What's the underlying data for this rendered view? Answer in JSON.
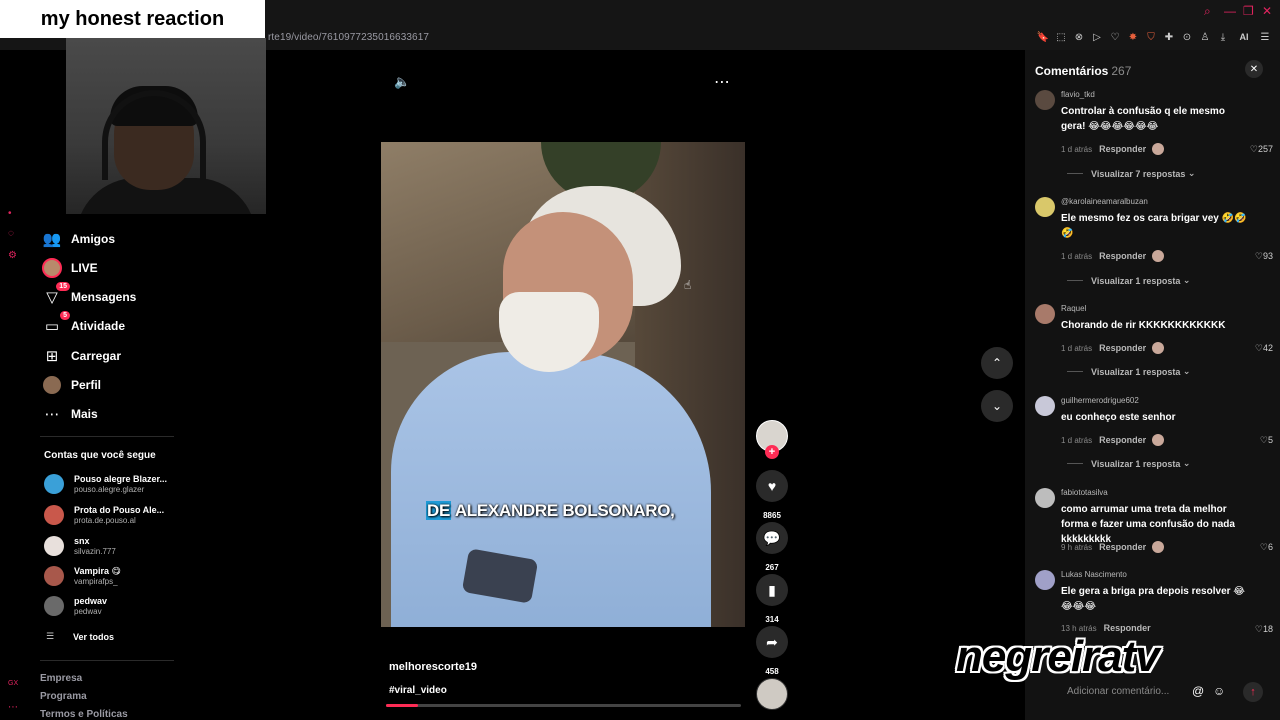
{
  "browser": {
    "url": "rte19/video/7610977235016633617",
    "toolbar_icons": [
      "bookmark-icon",
      "screenshot-icon",
      "block-icon",
      "play-icon",
      "heart-icon",
      "fox-icon",
      "shield-icon",
      "puzzle-icon",
      "lock-icon",
      "profile-icon",
      "download-icon",
      "pen-icon",
      "menu-icon"
    ],
    "ai_label": "AI"
  },
  "overlay": {
    "title": "my honest reaction"
  },
  "sidebar": {
    "nav": [
      {
        "label": "Amigos",
        "icon": "friends-icon"
      },
      {
        "label": "LIVE",
        "icon": "live-icon"
      },
      {
        "label": "Mensagens",
        "icon": "messages-icon",
        "badge": "15"
      },
      {
        "label": "Atividade",
        "icon": "activity-icon",
        "badge": "5"
      },
      {
        "label": "Carregar",
        "icon": "upload-icon"
      },
      {
        "label": "Perfil",
        "icon": "profile-icon"
      },
      {
        "label": "Mais",
        "icon": "more-icon"
      }
    ],
    "following_title": "Contas que você segue",
    "following": [
      {
        "name": "Pouso alegre Blazer...",
        "user": "pouso.alegre.glazer",
        "color": "#3aa0d8"
      },
      {
        "name": "Prota do Pouso Ale...",
        "user": "prota.de.pouso.al",
        "color": "#c9584b"
      },
      {
        "name": "snx",
        "user": "silvazin.777",
        "color": "#e8e0dc"
      },
      {
        "name": "Vampira 😋",
        "user": "vampirafps_",
        "color": "#a8584b"
      },
      {
        "name": "pedwav",
        "user": "pedwav",
        "color": "#6a6a6a"
      }
    ],
    "see_all": "Ver todos",
    "footer": [
      "Empresa",
      "Programa",
      "Termos e Políticas"
    ]
  },
  "video": {
    "caption_highlight": "DE",
    "caption_rest": " ALEXANDRE BOLSONARO,",
    "author": "melhorescorte19",
    "hashtag": "#viral_video",
    "progress": 0.09
  },
  "actions": {
    "likes": "8865",
    "comments": "267",
    "saves": "314",
    "shares": "458"
  },
  "comments_panel": {
    "title": "Comentários",
    "count": "267",
    "reply_label": "Responder",
    "input_placeholder": "Adicionar comentário...",
    "items": [
      {
        "user": "flavio_tkd",
        "text": "Controlar à confusão q ele mesmo gera! 😂😂😂😂😂😂",
        "time": "1 d atrás",
        "likes": "257",
        "replies": "Visualizar 7 respostas",
        "color": "#5a4a40"
      },
      {
        "user": "@karolaineamaralbuzan",
        "text": "Ele mesmo fez os cara brigar vey 🤣🤣🤣",
        "time": "1 d atrás",
        "likes": "93",
        "replies": "Visualizar 1 resposta",
        "color": "#d9c86a"
      },
      {
        "user": "Raquel",
        "text": "Chorando de rir KKKKKKKKKKKK",
        "time": "1 d atrás",
        "likes": "42",
        "replies": "Visualizar 1 resposta",
        "color": "#a87a6a"
      },
      {
        "user": "guilhermerodrigue602",
        "text": "eu conheço este senhor",
        "time": "1 d atrás",
        "likes": "5",
        "replies": "Visualizar 1 resposta",
        "color": "#c8c8d8"
      },
      {
        "user": "fabiototasilva",
        "text": "como arrumar uma treta da melhor forma e fazer uma confusão do nada kkkkkkkkk",
        "time": "9 h atrás",
        "likes": "6",
        "replies": "",
        "color": "#bdbdbd"
      },
      {
        "user": "Lukas Nascimento",
        "text": "Ele gera a briga pra depois resolver 😂😂😂😂",
        "time": "13 h atrás",
        "likes": "18",
        "replies": "",
        "color": "#a0a0c8"
      }
    ]
  },
  "watermark": "negreiratv"
}
